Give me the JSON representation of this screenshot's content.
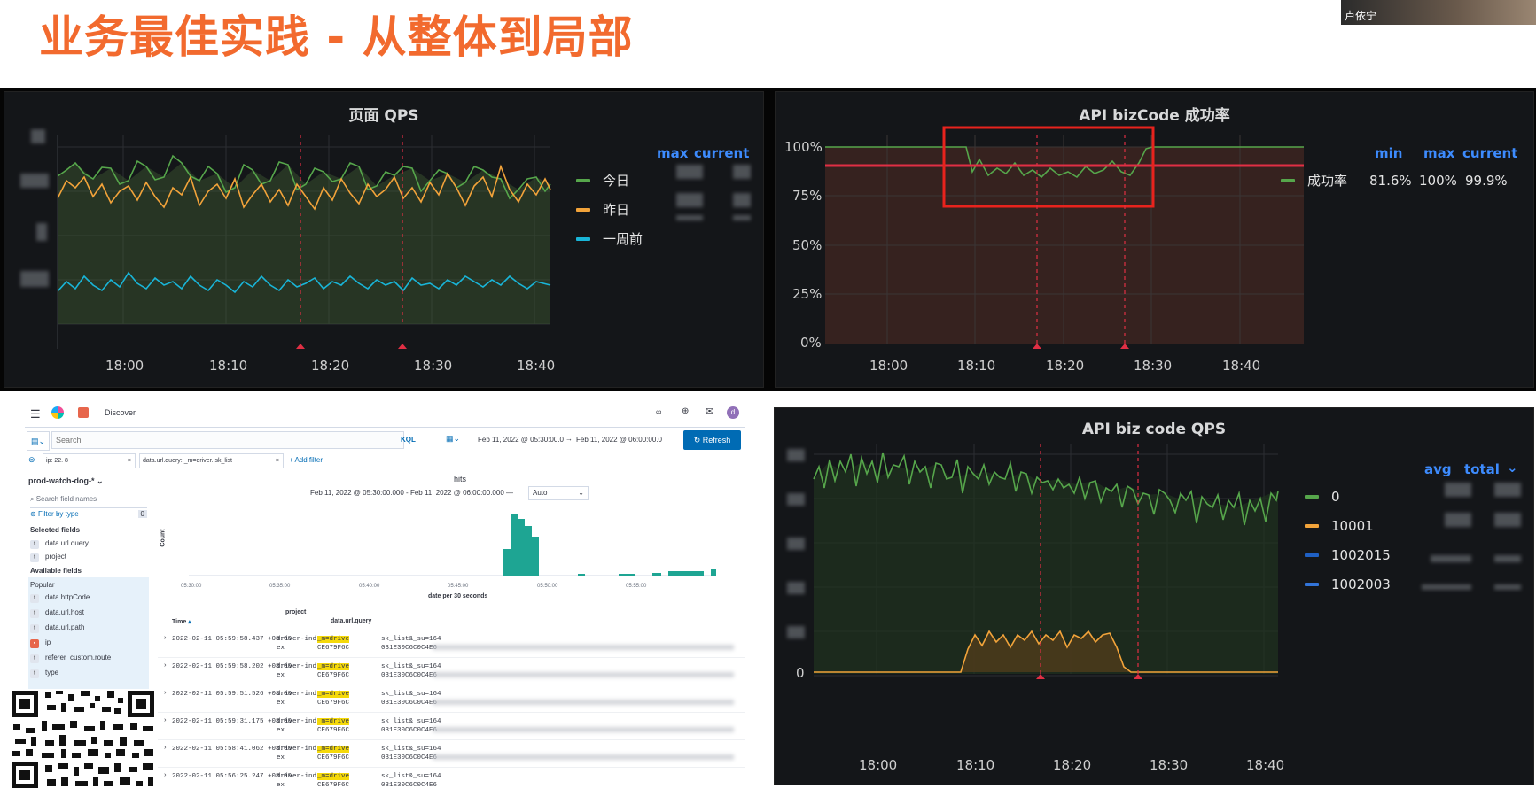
{
  "slide": {
    "title": "业务最佳实践 - 从整体到局部",
    "speaker_name": "卢依宁"
  },
  "panels": {
    "page_qps": {
      "title": "页面 QPS",
      "legend_headers": [
        "max",
        "current"
      ],
      "legend": [
        {
          "name": "今日",
          "color": "#56a64b"
        },
        {
          "name": "昨日",
          "color": "#f2a33a"
        },
        {
          "name": "一周前",
          "color": "#19b5d8"
        }
      ],
      "x_ticks": [
        "18:00",
        "18:10",
        "18:20",
        "18:30",
        "18:40"
      ]
    },
    "api_success": {
      "title": "API bizCode 成功率",
      "legend_headers": [
        "min",
        "max",
        "current"
      ],
      "legend": [
        {
          "name": "成功率",
          "min": "81.6%",
          "max": "100%",
          "current": "99.9%",
          "color": "#56a64b"
        }
      ],
      "y_ticks": [
        "100%",
        "75%",
        "50%",
        "25%",
        "0%"
      ],
      "x_ticks": [
        "18:00",
        "18:10",
        "18:20",
        "18:30",
        "18:40"
      ]
    },
    "biz_code_qps": {
      "title": "API biz code QPS",
      "legend_headers": [
        "avg",
        "total"
      ],
      "legend": [
        {
          "name": "0",
          "color": "#56a64b"
        },
        {
          "name": "10001",
          "color": "#f2a33a"
        },
        {
          "name": "1002015",
          "color": "#1f60c4"
        },
        {
          "name": "1002003",
          "color": "#3274d9"
        }
      ],
      "y_ticks": [
        "0"
      ],
      "x_ticks": [
        "18:00",
        "18:10",
        "18:20",
        "18:30",
        "18:40"
      ]
    }
  },
  "kibana": {
    "breadcrumb": "Discover",
    "avatar_letter": "d",
    "search_placeholder": "Search",
    "kql": "KQL",
    "time_from": "Feb 11, 2022 @ 05:30:00.0",
    "time_arrow": "→",
    "time_to": "Feb 11, 2022 @ 06:00:00.0",
    "refresh": "Refresh",
    "filters": [
      "ip: 22.          8",
      "data.url.query: _m=driver.         sk_list"
    ],
    "add_filter": "+ Add filter",
    "index_pattern": "prod-watch-dog-*",
    "search_field_names": "Search field names",
    "filter_by_type": "Filter by type",
    "filter_count": "0",
    "selected_fields_title": "Selected fields",
    "selected_fields": [
      "data.url.query",
      "project"
    ],
    "available_fields_title": "Available fields",
    "popular_title": "Popular",
    "popular_fields": [
      "data.httpCode",
      "data.url.host",
      "data.url.path",
      "ip",
      "referer_custom.route",
      "type"
    ],
    "hits": "hits",
    "date_range": "Feb 11, 2022 @ 05:30:00.000 - Feb 11, 2022 @ 06:00:00.000 —",
    "interval": "Auto",
    "count_label": "Count",
    "x_ticks": [
      "05:30:00",
      "05:35:00",
      "05:40:00",
      "05:45:00",
      "05:50:00",
      "05:55:00"
    ],
    "x_axis_label": "date per 30 seconds",
    "columns": [
      "Time",
      "project",
      "data.url.query"
    ],
    "rows": [
      {
        "time": "2022-02-11 05:59:58.437 +08:00",
        "project": "driver-ind",
        "project2": "ex",
        "q1": "_m=drive",
        "q2": "sk_list&_su=164",
        "q3": "CE679F6C",
        "q4": "031E30C6C0C4E6"
      },
      {
        "time": "2022-02-11 05:59:58.202 +08:00",
        "project": "driver-ind",
        "project2": "ex",
        "q1": "_m=drive",
        "q2": "sk_list&_su=164",
        "q3": "CE679F6C",
        "q4": "031E30C6C0C4E6"
      },
      {
        "time": "2022-02-11 05:59:51.526 +08:00",
        "project": "driver-ind",
        "project2": "ex",
        "q1": "_m=drive",
        "q2": "sk_list&_su=164",
        "q3": "CE679F6C",
        "q4": "031E30C6C0C4E6"
      },
      {
        "time": "2022-02-11 05:59:31.175 +08:00",
        "project": "driver-ind",
        "project2": "ex",
        "q1": "_m=drive",
        "q2": "sk_list&_su=164",
        "q3": "CE679F6C",
        "q4": "031E30C6C0C4E6"
      },
      {
        "time": "2022-02-11 05:58:41.062 +08:00",
        "project": "driver-ind",
        "project2": "ex",
        "q1": "_m=drive",
        "q2": "sk_list&_su=164",
        "q3": "CE679F6C",
        "q4": "031E30C6C0C4E6"
      },
      {
        "time": "2022-02-11 05:56:25.247 +08:00",
        "project": "driver-ind",
        "project2": "ex",
        "q1": "_m=drive",
        "q2": "sk_list&_su=164",
        "q3": "CE679F6C",
        "q4": "031E30C6C0C4E6"
      }
    ]
  },
  "colors": {
    "title": "#f26a2e",
    "panel_bg": "#141619",
    "green": "#56a64b",
    "orange": "#f2a33a",
    "cyan": "#19b5d8",
    "red": "#e02f44",
    "kibana_blue": "#006bb4"
  }
}
